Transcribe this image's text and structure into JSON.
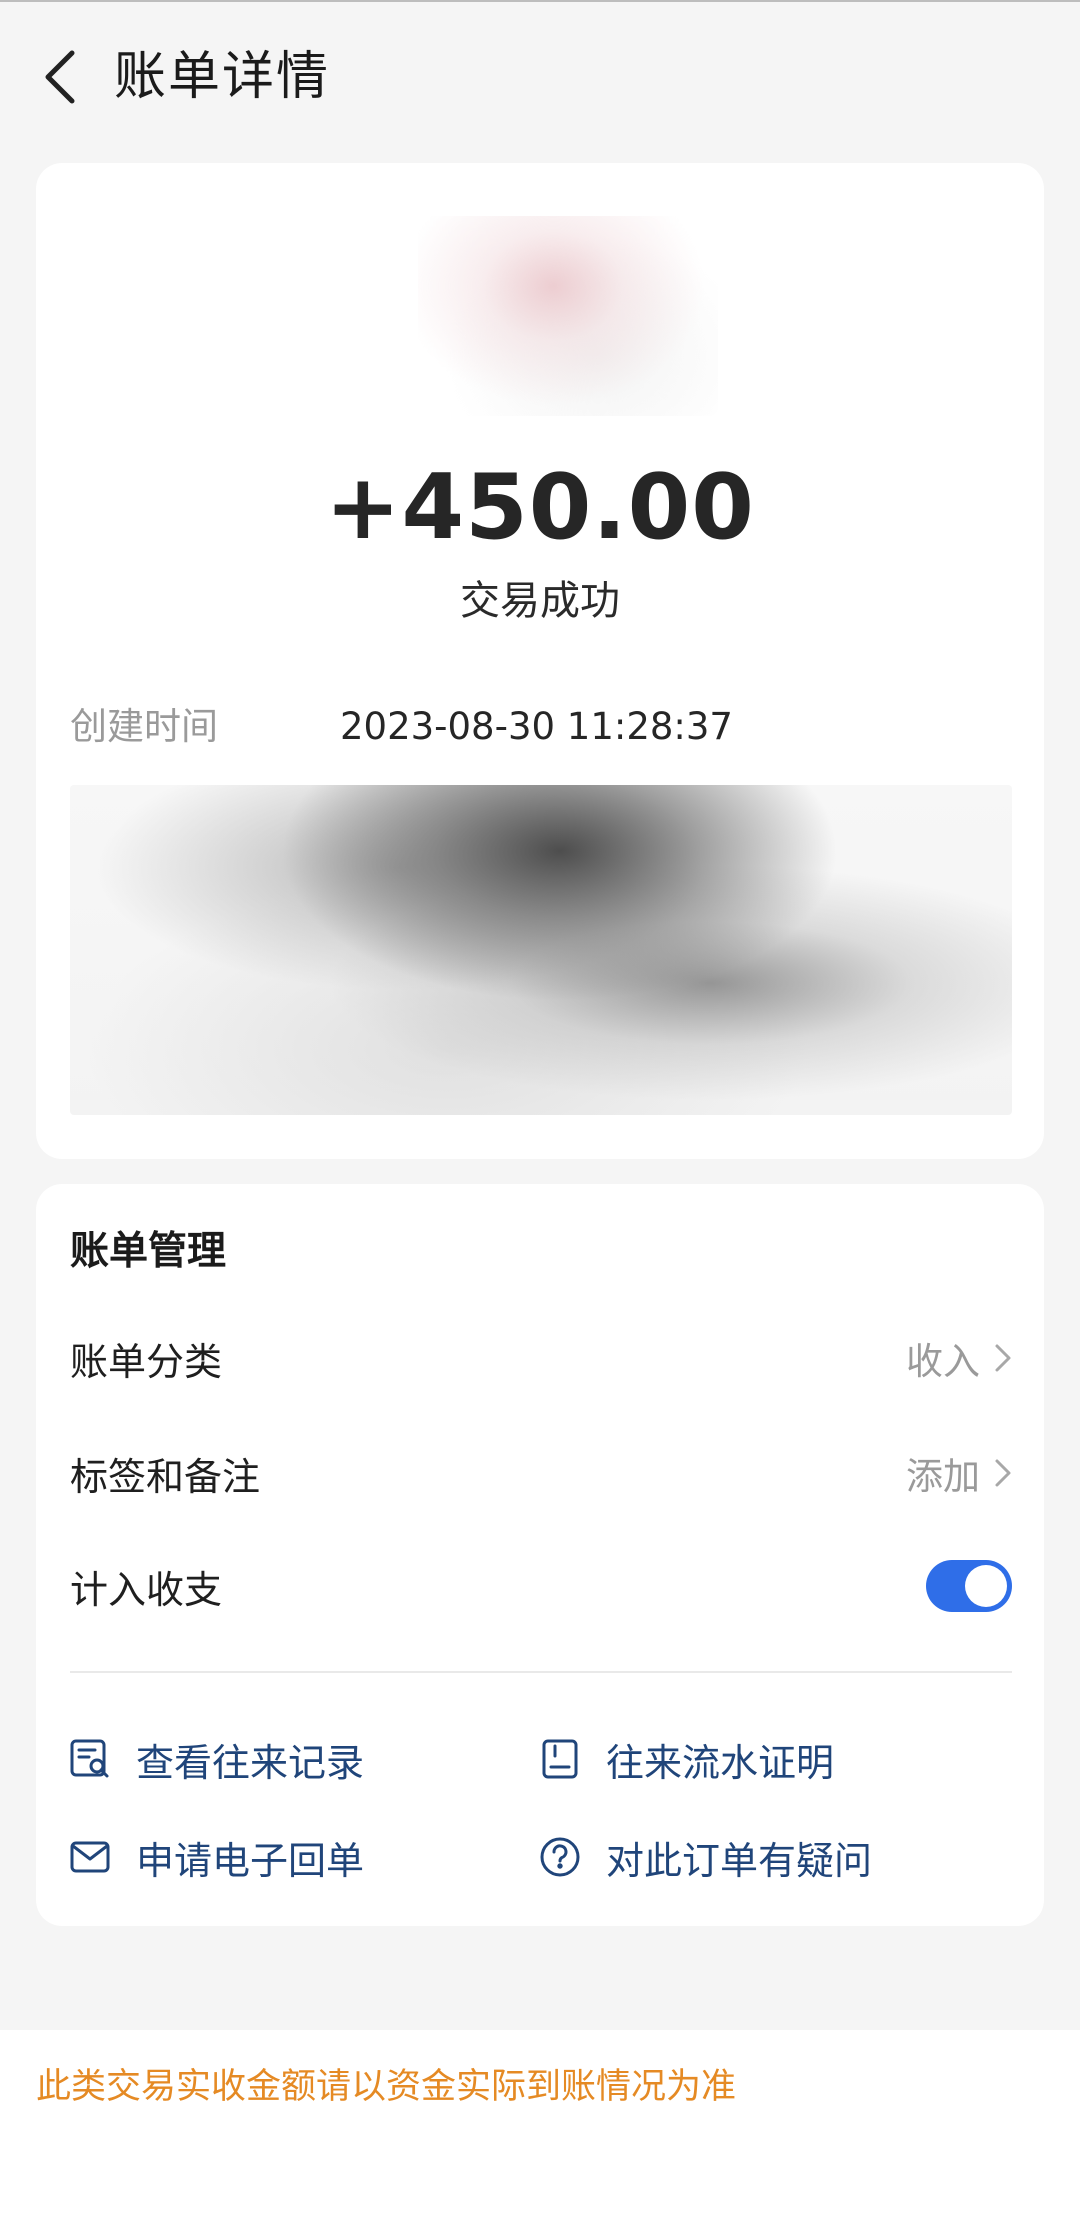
{
  "header": {
    "back_icon": "chevron-left-icon",
    "title": "账单详情"
  },
  "summary": {
    "amount": "+450.00",
    "status": "交易成功",
    "created_label": "创建时间",
    "created_value": "2023-08-30 11:28:37"
  },
  "manage": {
    "title": "账单管理",
    "category_label": "账单分类",
    "category_value": "收入",
    "tags_label": "标签和备注",
    "tags_value": "添加",
    "include_label": "计入收支",
    "include_toggle_on": true,
    "actions": [
      {
        "label": "查看往来记录",
        "icon": "records-search-icon"
      },
      {
        "label": "往来流水证明",
        "icon": "statement-doc-icon"
      },
      {
        "label": "申请电子回单",
        "icon": "mail-icon"
      },
      {
        "label": "对此订单有疑问",
        "icon": "question-circle-icon"
      }
    ]
  },
  "footer": {
    "notice": "此类交易实收金额请以资金实际到账情况为准"
  },
  "colors": {
    "accent": "#2f6ee8",
    "link_text": "#20457a",
    "notice": "#e58a24",
    "background": "#f5f5f5"
  }
}
